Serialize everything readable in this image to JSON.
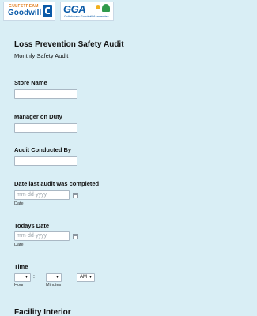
{
  "logos": {
    "left": {
      "top_text": "GULFSTREAM",
      "main_text": "Goodwill"
    },
    "right": {
      "main_text": "GGA",
      "sub_text": "Gulfstream Goodwill Academies"
    }
  },
  "form": {
    "title": "Loss Prevention Safety Audit",
    "subtitle": "Monthly Safety Audit",
    "store_name": {
      "label": "Store Name",
      "value": ""
    },
    "manager_on_duty": {
      "label": "Manager on Duty",
      "value": ""
    },
    "audit_conducted_by": {
      "label": "Audit Conducted By",
      "value": ""
    },
    "last_audit_date": {
      "label": "Date last audit was completed",
      "placeholder": "mm-dd-yyyy",
      "sublabel": "Date"
    },
    "todays_date": {
      "label": "Todays Date",
      "placeholder": "mm-dd-yyyy",
      "sublabel": "Date"
    },
    "time": {
      "label": "Time",
      "hour_value": "",
      "minute_value": "",
      "separator": ":",
      "ampm_value": "AM",
      "arrow": "▼",
      "hour_sublabel": "Hour",
      "minute_sublabel": "Minutes"
    },
    "next_section_heading": "Facility Interior"
  },
  "icons": {
    "calendar": "calendar-icon",
    "dropdown": "chevron-down-icon"
  }
}
